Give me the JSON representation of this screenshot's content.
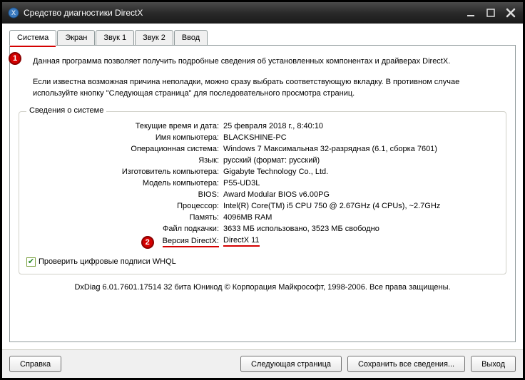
{
  "titlebar": {
    "title": "Средство диагностики DirectX"
  },
  "tabs": {
    "t0": "Система",
    "t1": "Экран",
    "t2": "Звук 1",
    "t3": "Звук 2",
    "t4": "Ввод"
  },
  "intro": {
    "p1": "Данная программа позволяет получить подробные сведения об установленных компонентах и драйверах DirectX.",
    "p2": "Если известна возможная причина неполадки, можно сразу выбрать соответствующую вкладку. В противном случае используйте кнопку \"Следующая страница\" для последовательного просмотра страниц."
  },
  "sysinfo": {
    "legend": "Сведения о системе",
    "rows": {
      "datetime_label": "Текущие время и дата:",
      "datetime_value": "25 февраля 2018 г., 8:40:10",
      "pcname_label": "Имя компьютера:",
      "pcname_value": "BLACKSHINE-PC",
      "os_label": "Операционная система:",
      "os_value": "Windows 7 Максимальная 32-разрядная (6.1, сборка 7601)",
      "lang_label": "Язык:",
      "lang_value": "русский (формат: русский)",
      "mfg_label": "Изготовитель компьютера:",
      "mfg_value": "Gigabyte Technology Co., Ltd.",
      "model_label": "Модель компьютера:",
      "model_value": "P55-UD3L",
      "bios_label": "BIOS:",
      "bios_value": "Award Modular BIOS v6.00PG",
      "cpu_label": "Процессор:",
      "cpu_value": "Intel(R) Core(TM) i5 CPU       750  @ 2.67GHz (4 CPUs), ~2.7GHz",
      "mem_label": "Память:",
      "mem_value": "4096MB RAM",
      "pagefile_label": "Файл подкачки:",
      "pagefile_value": "3633 МБ использовано, 3523 МБ свободно",
      "dxver_label": "Версия DirectX:",
      "dxver_value": "DirectX 11"
    }
  },
  "whql": {
    "label": "Проверить цифровые подписи WHQL"
  },
  "status": "DxDiag 6.01.7601.17514 32 бита Юникод  © Корпорация Майкрософт, 1998-2006. Все права защищены.",
  "buttons": {
    "help": "Справка",
    "next": "Следующая страница",
    "save": "Сохранить все сведения...",
    "exit": "Выход"
  },
  "badges": {
    "b1": "1",
    "b2": "2"
  }
}
